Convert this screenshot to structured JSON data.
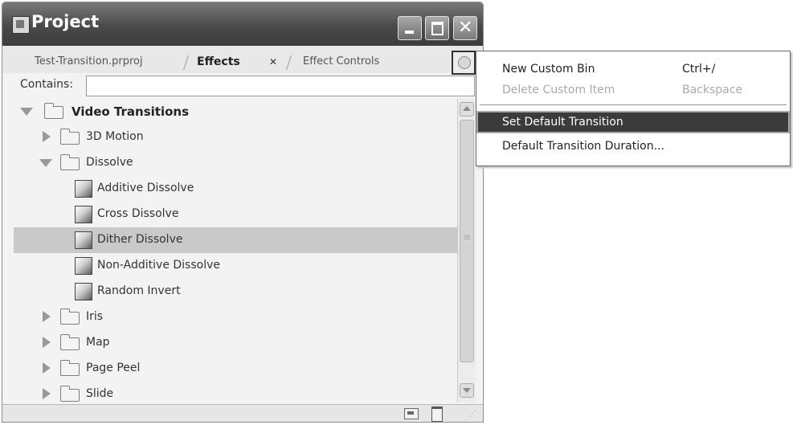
{
  "window": {
    "title": "Project",
    "buttons": [
      "minimize-icon",
      "maximize-icon",
      "close-icon"
    ]
  },
  "tabs": [
    {
      "label": "Test-Transition.prproj"
    },
    {
      "label": "Effects",
      "close": "✕"
    },
    {
      "label": "Effect Controls"
    }
  ],
  "search": {
    "label": "Contains:",
    "value": ""
  },
  "tree": [
    {
      "type": "folder",
      "label": "Video Transitions",
      "expanded": true
    },
    {
      "type": "folder",
      "label": "3D Motion",
      "expanded": false
    },
    {
      "type": "folder",
      "label": "Dissolve",
      "expanded": true
    },
    {
      "type": "effect",
      "label": "Additive Dissolve"
    },
    {
      "type": "effect",
      "label": "Cross Dissolve"
    },
    {
      "type": "effect",
      "label": "Dither Dissolve",
      "selected": true
    },
    {
      "type": "effect",
      "label": "Non-Additive Dissolve"
    },
    {
      "type": "effect",
      "label": "Random Invert"
    },
    {
      "type": "folder",
      "label": "Iris",
      "expanded": false
    },
    {
      "type": "folder",
      "label": "Map",
      "expanded": false
    },
    {
      "type": "folder",
      "label": "Page Peel",
      "expanded": false
    },
    {
      "type": "folder",
      "label": "Slide",
      "expanded": false
    }
  ],
  "menu": {
    "items": [
      {
        "label": "New Custom Bin",
        "shortcut": "Ctrl+/",
        "enabled": true
      },
      {
        "label": "Delete Custom Item",
        "shortcut": "Backspace",
        "enabled": false
      },
      {
        "label": "Set Default Transition",
        "shortcut": "",
        "enabled": true,
        "active": true
      },
      {
        "label": "Default Transition Duration...",
        "shortcut": "",
        "enabled": true
      }
    ]
  },
  "colors": {
    "titlebar": "#4a4a4a",
    "selection": "#c9c9c9",
    "menu_highlight": "#3b3b3b"
  }
}
